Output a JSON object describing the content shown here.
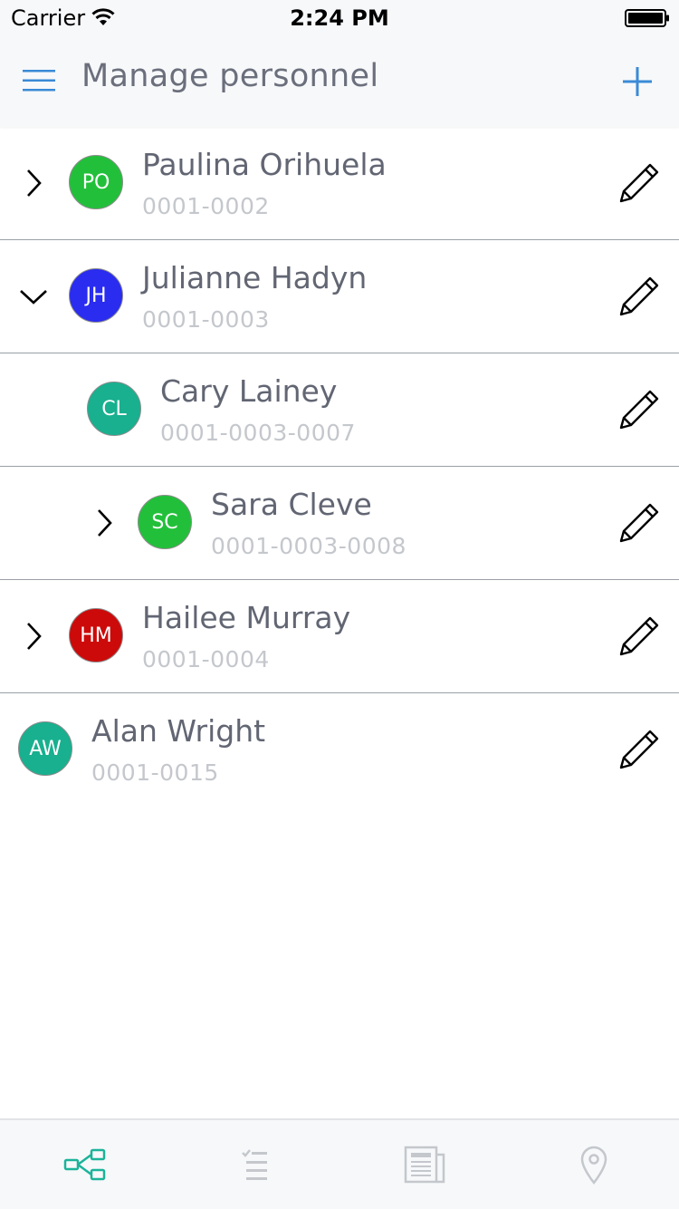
{
  "status_bar": {
    "carrier": "Carrier",
    "time": "2:24 PM"
  },
  "header": {
    "title": "Manage personnel"
  },
  "colors": {
    "accent": "#3a8ad6",
    "title_text": "#6b6f7c",
    "code_text": "#c4c7cc",
    "tab_active": "#1bb39a",
    "tab_inactive": "#c4c7cc"
  },
  "personnel": [
    {
      "name": "Paulina Orihuela",
      "code": "0001-0002",
      "initials": "PO",
      "avatar_color": "#22c03a",
      "indent_level": 0,
      "expander": "collapsed"
    },
    {
      "name": "Julianne Hadyn",
      "code": "0001-0003",
      "initials": "JH",
      "avatar_color": "#2a2cf0",
      "indent_level": 0,
      "expander": "expanded"
    },
    {
      "name": "Cary Lainey",
      "code": "0001-0003-0007",
      "initials": "CL",
      "avatar_color": "#18b08f",
      "indent_level": 1,
      "expander": "none"
    },
    {
      "name": "Sara Cleve",
      "code": "0001-0003-0008",
      "initials": "SC",
      "avatar_color": "#22c03a",
      "indent_level": 1,
      "expander": "collapsed"
    },
    {
      "name": "Hailee Murray",
      "code": "0001-0004",
      "initials": "HM",
      "avatar_color": "#cc0a0a",
      "indent_level": 0,
      "expander": "collapsed"
    },
    {
      "name": "Alan Wright",
      "code": "0001-0015",
      "initials": "AW",
      "avatar_color": "#18b08f",
      "indent_level": 0,
      "expander": "none"
    }
  ],
  "tabs": [
    {
      "icon": "hierarchy-icon",
      "active": true
    },
    {
      "icon": "checklist-icon",
      "active": false
    },
    {
      "icon": "document-icon",
      "active": false
    },
    {
      "icon": "location-pin-icon",
      "active": false
    }
  ]
}
